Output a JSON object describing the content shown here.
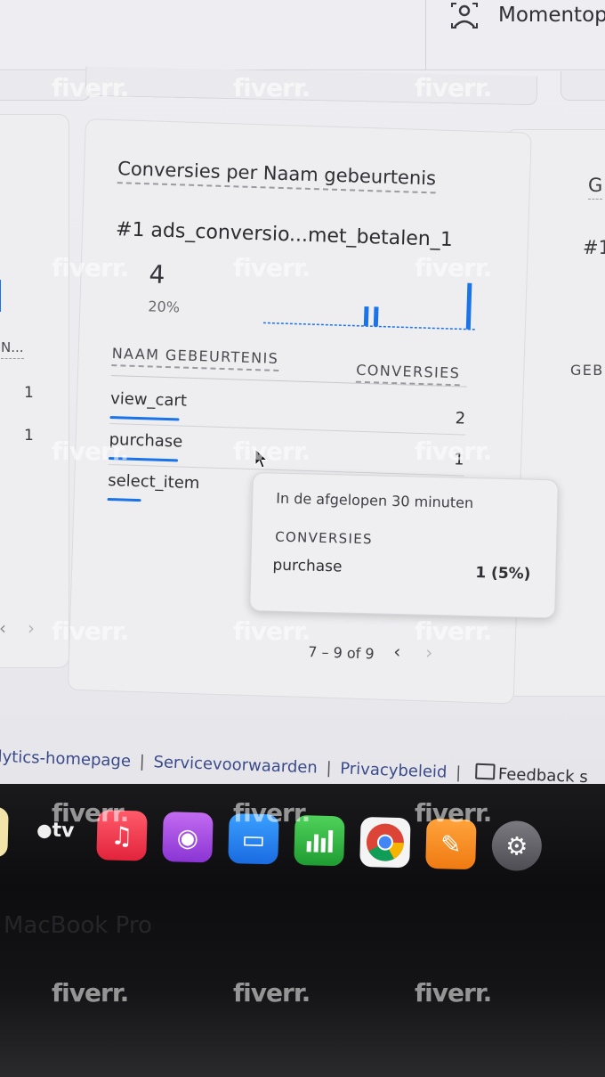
{
  "header": {
    "app_label": "Momentop"
  },
  "card": {
    "title": "Conversies per Naam gebeurtenis",
    "top_item": "#1  ads_conversio...met_betalen_1",
    "top_value": "4",
    "top_percent": "20%",
    "columns": {
      "name": "NAAM GEBEURTENIS",
      "value": "CONVERSIES"
    },
    "rows": [
      {
        "name": "view_cart",
        "value": "2"
      },
      {
        "name": "purchase",
        "value": "1"
      },
      {
        "name": "select_item",
        "value": ""
      }
    ],
    "pagination": {
      "range": "7 – 9 of 9",
      "prev": "‹",
      "next": "›"
    }
  },
  "tooltip": {
    "header": "In de afgelopen 30 minuten",
    "metric": "CONVERSIES",
    "event": "purchase",
    "value": "1 (5%)"
  },
  "left_card": {
    "col_header": "N...",
    "values": [
      "1",
      "1"
    ]
  },
  "right_card": {
    "title_fragment": "G",
    "top_fragment": "#1",
    "col_fragment": "GEB"
  },
  "footer": {
    "links": [
      "lytics-homepage",
      "Servicevoorwaarden",
      "Privacybeleid"
    ],
    "separator": "|",
    "feedback": "Feedback s"
  },
  "dock": {
    "tv_label": "tv",
    "apps": [
      "music-icon",
      "podcasts-icon",
      "keynote-icon",
      "numbers-icon",
      "chrome-icon",
      "pages-icon",
      "system-preferences-icon"
    ]
  },
  "device": {
    "label": "MacBook Pro"
  },
  "watermark": {
    "text": "fiverr."
  },
  "colors": {
    "accent": "#1a73e8",
    "link": "#3a4a8a"
  }
}
